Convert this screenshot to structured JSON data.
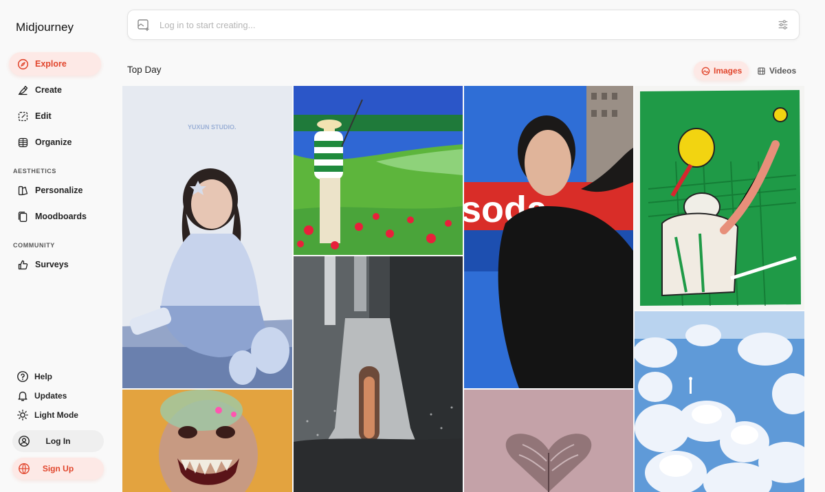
{
  "app": {
    "name": "Midjourney"
  },
  "nav": {
    "explore": "Explore",
    "create": "Create",
    "edit": "Edit",
    "organize": "Organize",
    "aesthetics_heading": "AESTHETICS",
    "personalize": "Personalize",
    "moodboards": "Moodboards",
    "community_heading": "COMMUNITY",
    "surveys": "Surveys"
  },
  "footer": {
    "help": "Help",
    "updates": "Updates",
    "light_mode": "Light Mode",
    "login": "Log In",
    "signup": "Sign Up"
  },
  "search": {
    "placeholder": "Log in to start creating..."
  },
  "feed": {
    "title": "Top Day",
    "toggle_images": "Images",
    "toggle_videos": "Videos",
    "active_tab": "Images"
  },
  "gallery": {
    "images": [
      {
        "name": "girl-blue-outfit-photo",
        "watermark": "YUXUN STUDIO."
      },
      {
        "name": "fisherman-painting"
      },
      {
        "name": "woman-black-coat-photo",
        "sign_text": "soda"
      },
      {
        "name": "tennis-player-illustration"
      },
      {
        "name": "silver-tower-render"
      },
      {
        "name": "vampire-face-render"
      },
      {
        "name": "glass-heart-sculpture"
      },
      {
        "name": "white-flowers-astronaut"
      }
    ]
  },
  "colors": {
    "accent": "#e1462d",
    "accent_bg": "#fde9e6",
    "background": "#f9f9f9"
  }
}
